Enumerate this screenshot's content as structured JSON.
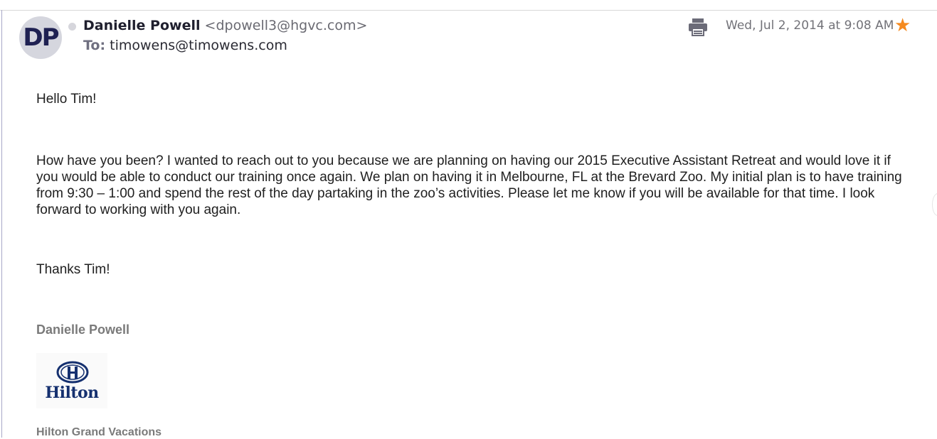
{
  "header": {
    "avatar_initials": "DP",
    "sender_name": "Danielle Powell",
    "sender_email": "<dpowell3@hgvc.com>",
    "to_label": "To:",
    "to_value": "timowens@timowens.com",
    "date": "Wed, Jul 2, 2014 at 9:08 AM",
    "print_icon": "printer-icon",
    "star_icon": "star-icon",
    "star_color": "#f58a1f"
  },
  "body": {
    "greeting": "Hello Tim!",
    "paragraph": "How have you been?  I wanted to reach out to you because we are planning on having our 2015 Executive Assistant Retreat and would love it if you would be able to conduct our training once again.  We plan on having it in Melbourne, FL at the Brevard Zoo.  My initial plan is to have training from 9:30 – 1:00 and spend the rest of the day partaking in the zoo’s activities.  Please let me know if you will be available for that time. I look forward to working with you again.",
    "thanks": "Thanks Tim!"
  },
  "signature": {
    "name": "Danielle Powell",
    "logo_text": "Hilton",
    "company": "Hilton Grand Vacations"
  }
}
